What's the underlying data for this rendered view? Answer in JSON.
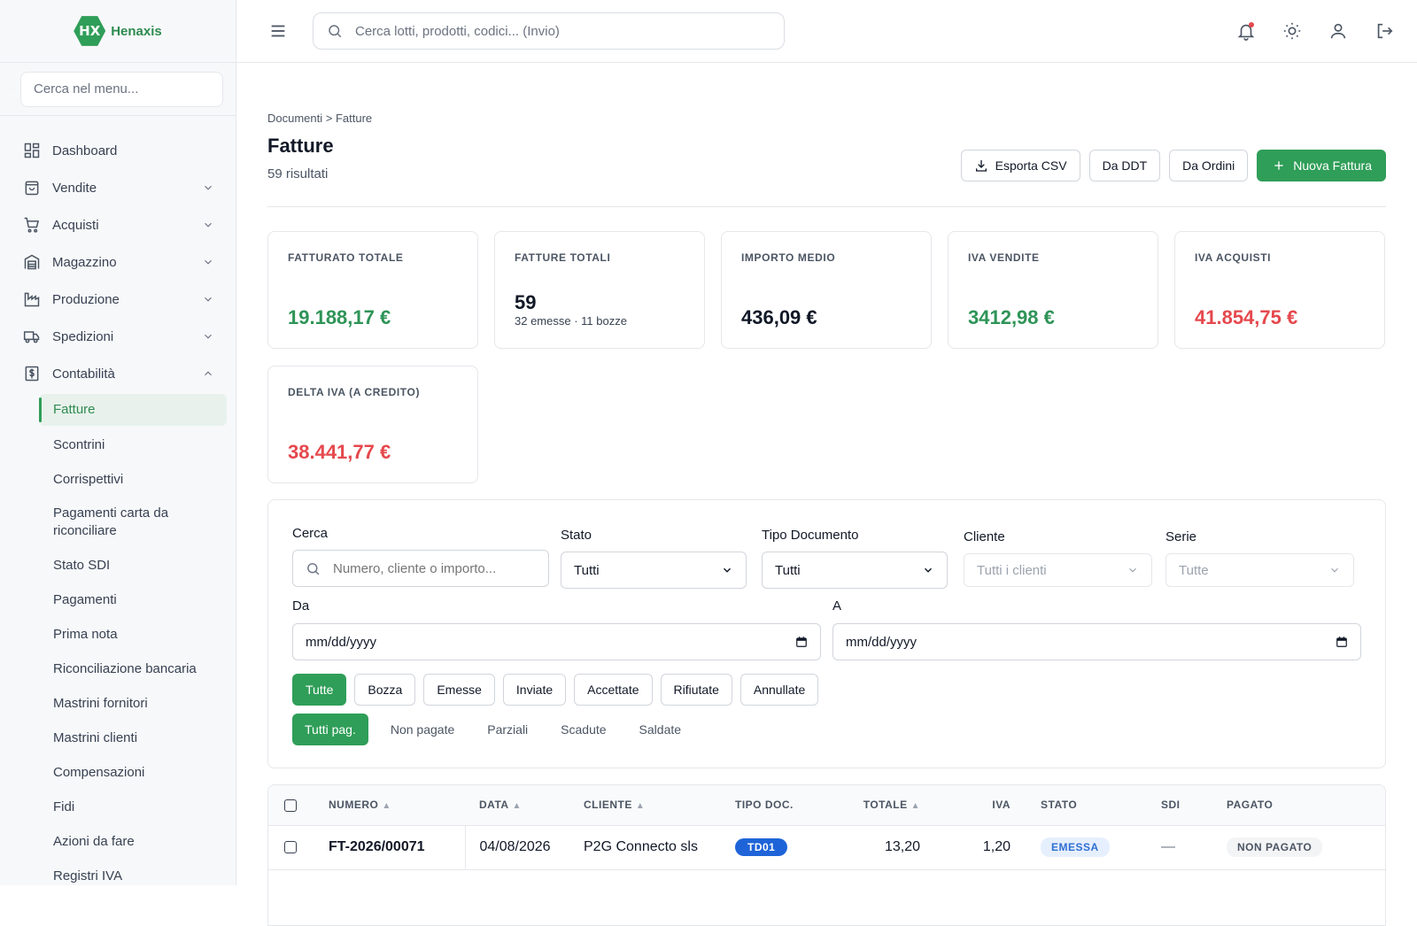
{
  "brand": {
    "name": "Henaxis",
    "mark": "HX"
  },
  "menu_search": {
    "placeholder": "Cerca nel menu..."
  },
  "nav": {
    "dashboard": "Dashboard",
    "vendite": "Vendite",
    "acquisti": "Acquisti",
    "magazzino": "Magazzino",
    "produzione": "Produzione",
    "spedizioni": "Spedizioni",
    "contabilita": "Contabilità",
    "sub": [
      "Fatture",
      "Scontrini",
      "Corrispettivi",
      "Pagamenti carta da riconciliare",
      "Stato SDI",
      "Pagamenti",
      "Prima nota",
      "Riconciliazione bancaria",
      "Mastrini fornitori",
      "Mastrini clienti",
      "Compensazioni",
      "Fidi",
      "Azioni da fare",
      "Registri IVA"
    ]
  },
  "topbar": {
    "search_placeholder": "Cerca lotti, prodotti, codici... (Invio)"
  },
  "header": {
    "breadcrumb": "Documenti > Fatture",
    "title": "Fatture",
    "results": "59 risultati",
    "export_label": "Esporta CSV",
    "ddt_label": "Da DDT",
    "ordini_label": "Da Ordini",
    "new_label": "Nuova Fattura"
  },
  "kpis": {
    "fatturato": {
      "label": "FATTURATO TOTALE",
      "value": "19.188,17 €"
    },
    "fatture": {
      "label": "FATTURE TOTALI",
      "value": "59",
      "sub": "32 emesse · 11 bozze"
    },
    "medio": {
      "label": "IMPORTO MEDIO",
      "value": "436,09 €"
    },
    "iva_vendite": {
      "label": "IVA VENDITE",
      "value": "3412,98 €"
    },
    "iva_acquisti": {
      "label": "IVA ACQUISTI",
      "value": "41.854,75 €"
    },
    "delta": {
      "label": "DELTA IVA (A CREDITO)",
      "value": "38.441,77 €"
    }
  },
  "filters": {
    "cerca_label": "Cerca",
    "cerca_placeholder": "Numero, cliente o importo...",
    "stato_label": "Stato",
    "stato_value": "Tutti",
    "tipo_label": "Tipo Documento",
    "tipo_value": "Tutti",
    "cliente_label": "Cliente",
    "cliente_value": "Tutti i clienti",
    "serie_label": "Serie",
    "serie_value": "Tutte",
    "da_label": "Da",
    "da_value": "mm/dd/yyyy",
    "a_label": "A",
    "a_value": "mm/dd/yyyy",
    "status_chips": [
      "Tutte",
      "Bozza",
      "Emesse",
      "Inviate",
      "Accettate",
      "Rifiutate",
      "Annullate"
    ],
    "payment_tabs": [
      "Tutti pag.",
      "Non pagate",
      "Parziali",
      "Scadute",
      "Saldate"
    ]
  },
  "table": {
    "headers": [
      "NUMERO",
      "DATA",
      "CLIENTE",
      "TIPO DOC.",
      "TOTALE",
      "IVA",
      "STATO",
      "SDI",
      "PAGATO"
    ],
    "rows": [
      {
        "numero": "FT-2026/00071",
        "data": "04/08/2026",
        "cliente": "P2G Connecto sls",
        "tipo": "TD01",
        "totale": "13,20",
        "iva": "1,20",
        "stato": "EMESSA",
        "sdi": "—",
        "pagato": "NON PAGATO"
      }
    ]
  },
  "colors": {
    "accent": "#2f9e58",
    "negative": "#e5484d",
    "badge_blue": "#1e64d8"
  }
}
